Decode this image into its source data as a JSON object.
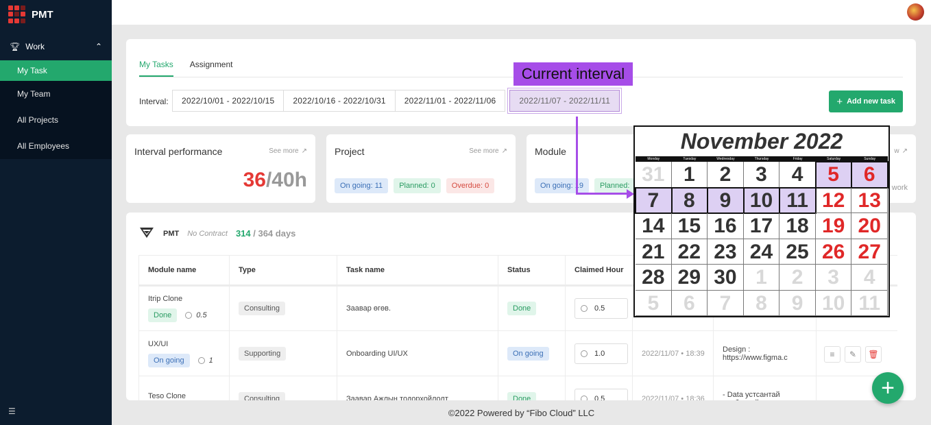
{
  "brand": {
    "name": "PMT"
  },
  "sidebar": {
    "group_label": "Work",
    "items": [
      {
        "label": "My Task",
        "active": true
      },
      {
        "label": "My Team"
      },
      {
        "label": "All Projects"
      },
      {
        "label": "All Employees"
      }
    ]
  },
  "tabs": [
    "My Tasks",
    "Assignment"
  ],
  "interval": {
    "label": "Interval:",
    "options": [
      "2022/10/01 - 2022/10/15",
      "2022/10/16 - 2022/10/31",
      "2022/11/01 - 2022/11/06",
      "2022/11/07 - 2022/11/11"
    ],
    "selected_index": 3
  },
  "add_task_label": "Add new task",
  "callout_text": "Current interval",
  "stats": {
    "interval": {
      "title": "Interval performance",
      "see_more": "See more",
      "current": "36",
      "total": "/40h"
    },
    "project": {
      "title": "Project",
      "see_more": "See more",
      "ongoing": "On going: 11",
      "planned": "Planned: 0",
      "overdue": "Overdue: 0"
    },
    "module": {
      "title": "Module",
      "see_more": "w",
      "ongoing": "On going: 19",
      "planned": "Planned:",
      "extra": "work"
    }
  },
  "project": {
    "name": "PMT",
    "contract": "No Contract",
    "days_used": "314",
    "days_total": " / 364 days"
  },
  "table": {
    "headers": [
      "Module name",
      "Type",
      "Task name",
      "Status",
      "Claimed Hour"
    ],
    "rows": [
      {
        "module": "Itrip Clone",
        "module_status": "Done",
        "module_hours": "0.5",
        "type": "Consulting",
        "task": "Заавар өгөв.",
        "status": "Done",
        "hours": "0.5",
        "date": "",
        "note": ""
      },
      {
        "module": "UX/UI",
        "module_status": "On going",
        "module_hours": "1",
        "type": "Supporting",
        "task": "Onboarding UI/UX",
        "status": "On going",
        "hours": "1.0",
        "date": "2022/11/07 • 18:39",
        "note": "Design : https://www.figma.c"
      },
      {
        "module": "Teso Clone",
        "module_status": "",
        "module_hours": "",
        "type": "Consulting",
        "task": "Заавар Ажлын тодорхойлолт",
        "status": "Done",
        "hours": "0.5",
        "date": "2022/11/07 • 18:36",
        "note": "- Data устсантай холбоотой"
      }
    ]
  },
  "calendar": {
    "title": "November 2022",
    "day_names": [
      "Monday",
      "Tuesday",
      "Wednesday",
      "Thursday",
      "Friday",
      "Saturday",
      "Sunday"
    ],
    "weeks": [
      [
        "31",
        "1",
        "2",
        "3",
        "4",
        "5",
        "6"
      ],
      [
        "7",
        "8",
        "9",
        "10",
        "11",
        "12",
        "13"
      ],
      [
        "14",
        "15",
        "16",
        "17",
        "18",
        "19",
        "20"
      ],
      [
        "21",
        "22",
        "23",
        "24",
        "25",
        "26",
        "27"
      ],
      [
        "28",
        "29",
        "30",
        "1",
        "2",
        "3",
        "4"
      ],
      [
        "5",
        "6",
        "7",
        "8",
        "9",
        "10",
        "11"
      ]
    ],
    "highlighted": [
      "5",
      "6",
      "7",
      "8",
      "9",
      "10",
      "11"
    ]
  },
  "footer": "©2022 Powered by “Fibo Cloud” LLC",
  "colors": {
    "accent": "#23a86d",
    "sidebar": "#0c1c2e",
    "highlight": "#a64de8",
    "danger": "#e53935"
  }
}
